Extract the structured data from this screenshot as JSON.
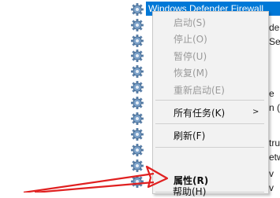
{
  "service_list": {
    "selected_service": "Windows Defender Firewall",
    "row_fragments": [
      "der",
      "Ser",
      "e",
      "n (W",
      "trun",
      "etwo",
      "v",
      "v"
    ]
  },
  "context_menu": {
    "items": [
      {
        "label": "启动(S)",
        "enabled": false
      },
      {
        "label": "停止(O)",
        "enabled": false
      },
      {
        "label": "暂停(U)",
        "enabled": false
      },
      {
        "label": "恢复(M)",
        "enabled": false
      },
      {
        "label": "重新启动(E)",
        "enabled": false
      },
      {
        "label": "所有任务(K)",
        "enabled": true,
        "submenu": true
      },
      {
        "label": "刷新(F)",
        "enabled": true
      },
      {
        "label": "属性(R)",
        "enabled": true,
        "bold": true
      },
      {
        "label": "帮助(H)",
        "enabled": true
      }
    ],
    "submenu_glyph": ">"
  },
  "annotation": {
    "arrow_color": "#e02020",
    "target": "属性(R)"
  },
  "icons": {
    "service_icon": "gear-icon"
  },
  "colors": {
    "selection": "#0078d7",
    "menu_bg": "#f2f2f2",
    "disabled_text": "#9a9a9a"
  }
}
